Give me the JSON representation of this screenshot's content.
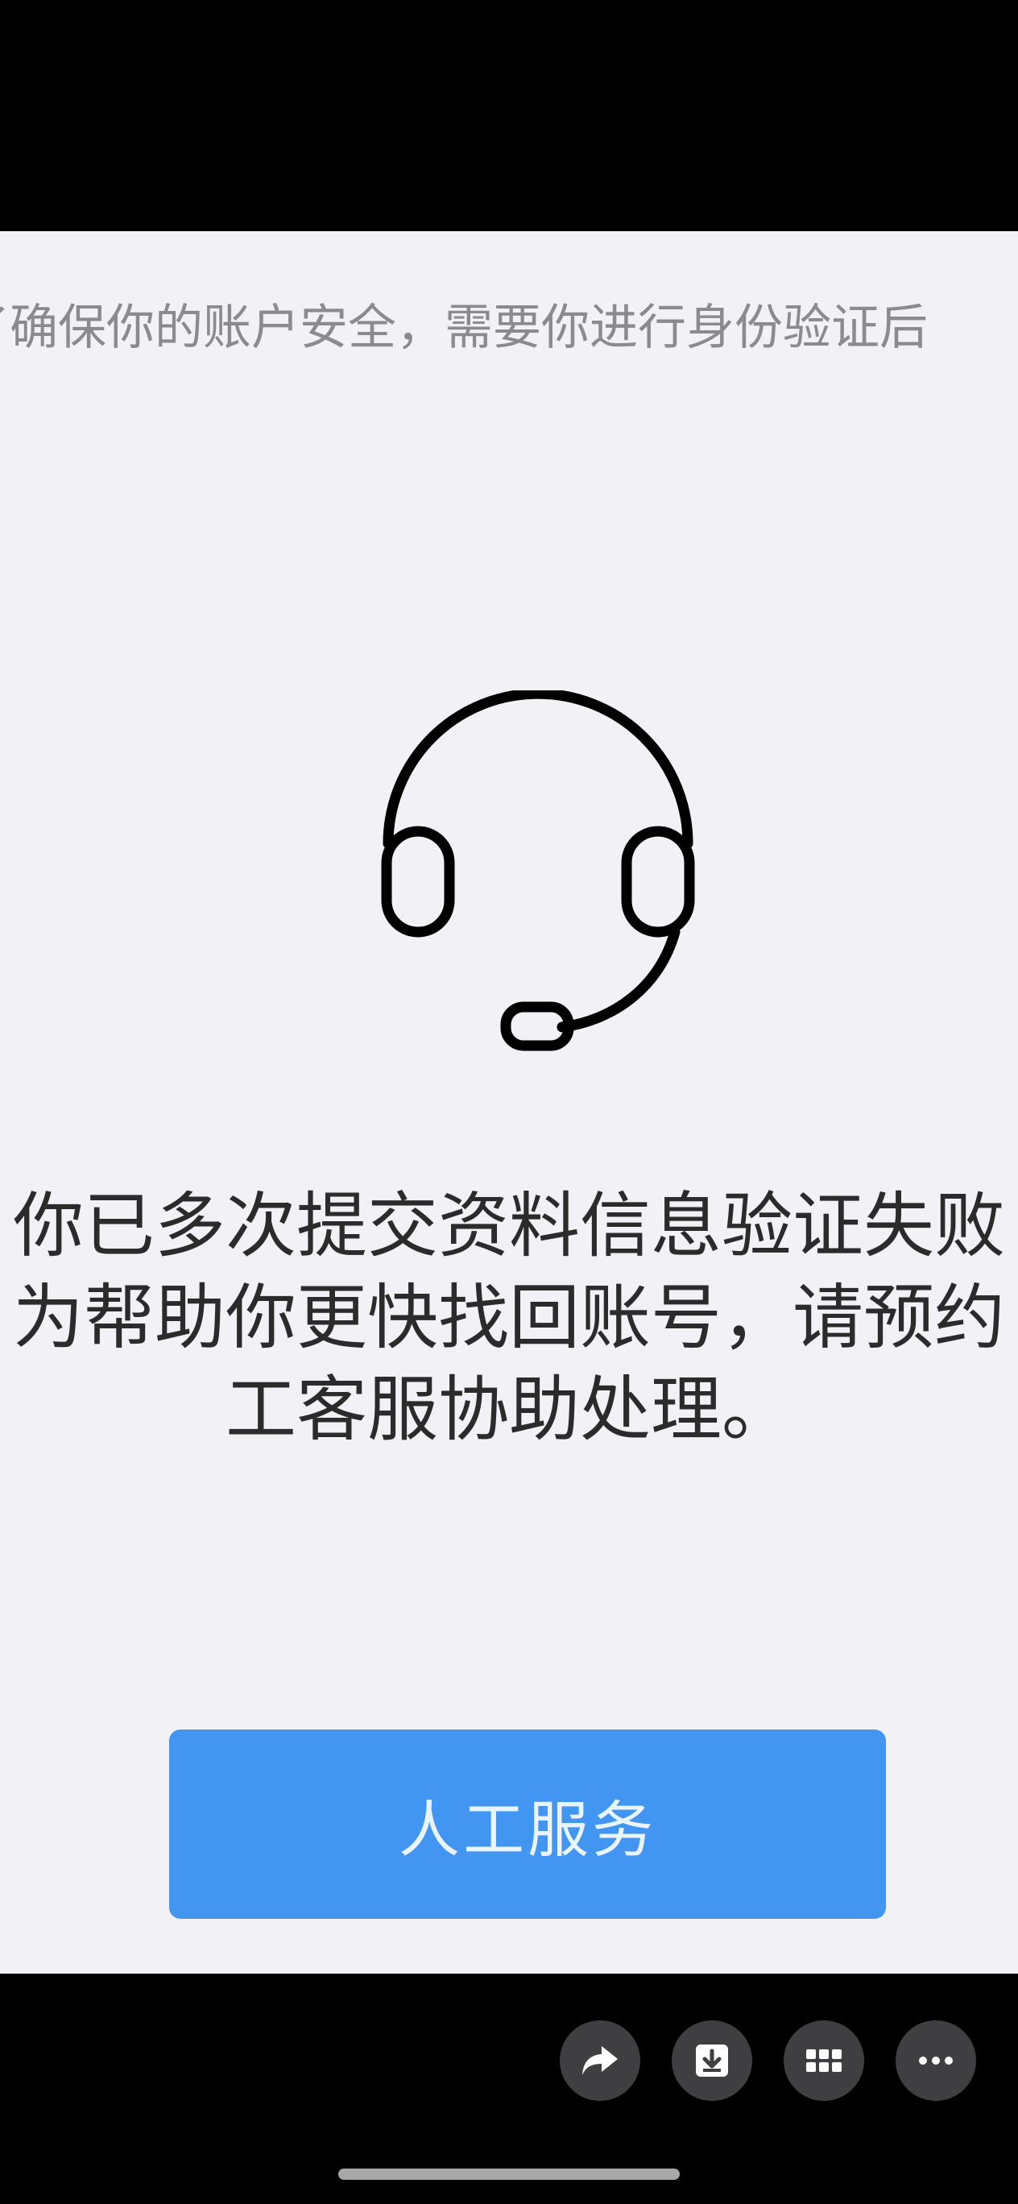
{
  "notice": {
    "text": "了确保你的账户安全，需要你进行身份验证后"
  },
  "icon": {
    "name": "headset-icon"
  },
  "message": {
    "line1": "你已多次提交资料信息验证失败",
    "line2": "为帮助你更快找回账号，请预约",
    "line3": "工客服协助处理。"
  },
  "button": {
    "label": "人工服务",
    "color": "#4296f2"
  },
  "toolbar": {
    "icons": [
      "share-icon",
      "download-icon",
      "grid-icon",
      "more-icon"
    ]
  },
  "colors": {
    "background": "#f1f1f6",
    "text": "#2b2b2b",
    "muted": "#8a8a8f"
  }
}
